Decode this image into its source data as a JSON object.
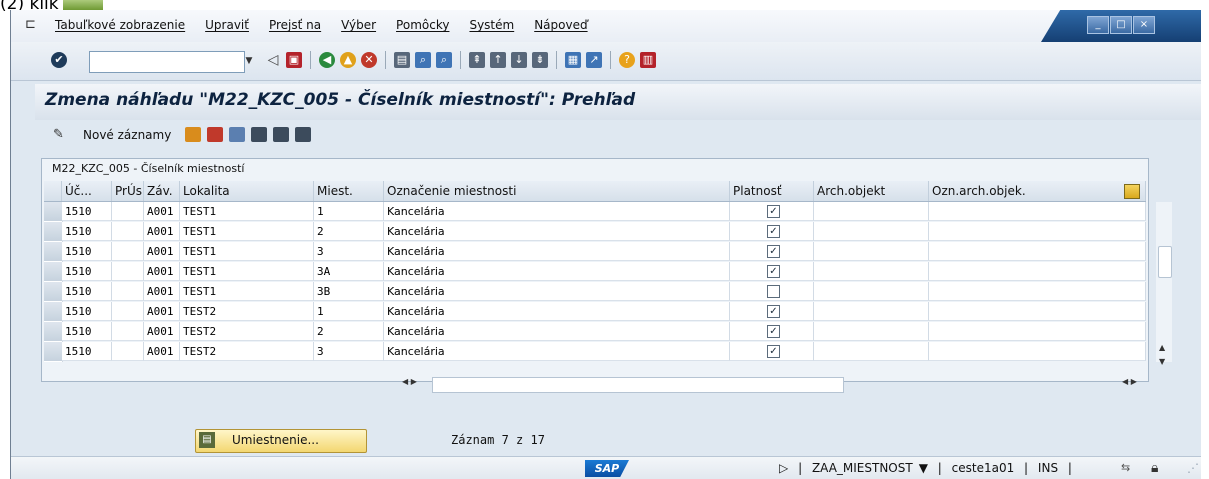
{
  "caption": {
    "text": "(2) klik"
  },
  "menu": {
    "items": [
      "Tabuľkové zobrazenie",
      "Upraviť",
      "Prejsť na",
      "Výber",
      "Pomôcky",
      "Systém",
      "Nápoveď"
    ]
  },
  "window_buttons": {
    "minimize": "_",
    "maximize": "□",
    "close": "×"
  },
  "toolbar": {
    "command_value": "",
    "icons": [
      "back-icon",
      "save-icon",
      "green-back-icon",
      "exit-icon",
      "cancel-icon",
      "print-icon",
      "find-icon",
      "find-next-icon",
      "first-page-icon",
      "prev-page-icon",
      "next-page-icon",
      "last-page-icon",
      "new-session-icon",
      "shortcut-icon",
      "help-icon",
      "layout-icon"
    ]
  },
  "title": {
    "text": "Zmena náhľadu \"M22_KZC_005 - Číselník miestností\": Prehľad"
  },
  "app_toolbar": {
    "new_entries": "Nové záznamy"
  },
  "table": {
    "title": "M22_KZC_005 - Číselník miestností",
    "columns": [
      "Úč...",
      "PrÚs",
      "Záv.",
      "Lokalita",
      "Miest.",
      "Označenie miestnosti",
      "Platnosť",
      "Arch.objekt",
      "Ozn.arch.objek."
    ],
    "rows": [
      {
        "uc": "1510",
        "prus": "",
        "zav": "A001",
        "lokalita": "TEST1",
        "miest": "1",
        "oznacenie": "Kancelária",
        "platnost": true,
        "arch": "",
        "ozn_arch": ""
      },
      {
        "uc": "1510",
        "prus": "",
        "zav": "A001",
        "lokalita": "TEST1",
        "miest": "2",
        "oznacenie": "Kancelária",
        "platnost": true,
        "arch": "",
        "ozn_arch": ""
      },
      {
        "uc": "1510",
        "prus": "",
        "zav": "A001",
        "lokalita": "TEST1",
        "miest": "3",
        "oznacenie": "Kancelária",
        "platnost": true,
        "arch": "",
        "ozn_arch": ""
      },
      {
        "uc": "1510",
        "prus": "",
        "zav": "A001",
        "lokalita": "TEST1",
        "miest": "3A",
        "oznacenie": "Kancelária",
        "platnost": true,
        "arch": "",
        "ozn_arch": ""
      },
      {
        "uc": "1510",
        "prus": "",
        "zav": "A001",
        "lokalita": "TEST1",
        "miest": "3B",
        "oznacenie": "Kancelária",
        "platnost": false,
        "arch": "",
        "ozn_arch": ""
      },
      {
        "uc": "1510",
        "prus": "",
        "zav": "A001",
        "lokalita": "TEST2",
        "miest": "1",
        "oznacenie": "Kancelária",
        "platnost": true,
        "arch": "",
        "ozn_arch": ""
      },
      {
        "uc": "1510",
        "prus": "",
        "zav": "A001",
        "lokalita": "TEST2",
        "miest": "2",
        "oznacenie": "Kancelária",
        "platnost": true,
        "arch": "",
        "ozn_arch": ""
      },
      {
        "uc": "1510",
        "prus": "",
        "zav": "A001",
        "lokalita": "TEST2",
        "miest": "3",
        "oznacenie": "Kancelária",
        "platnost": true,
        "arch": "",
        "ozn_arch": ""
      }
    ]
  },
  "location_button": {
    "label": "Umiestnenie..."
  },
  "record_info": {
    "text": "Záznam 7 z 17"
  },
  "status": {
    "logo": "SAP",
    "transaction": "ZAA_MIESTNOST",
    "server": "ceste1a01",
    "mode": "INS"
  },
  "colors": {
    "title": "#0d2340",
    "window_bg": "#dfe8f1",
    "button": "#f3d771"
  }
}
